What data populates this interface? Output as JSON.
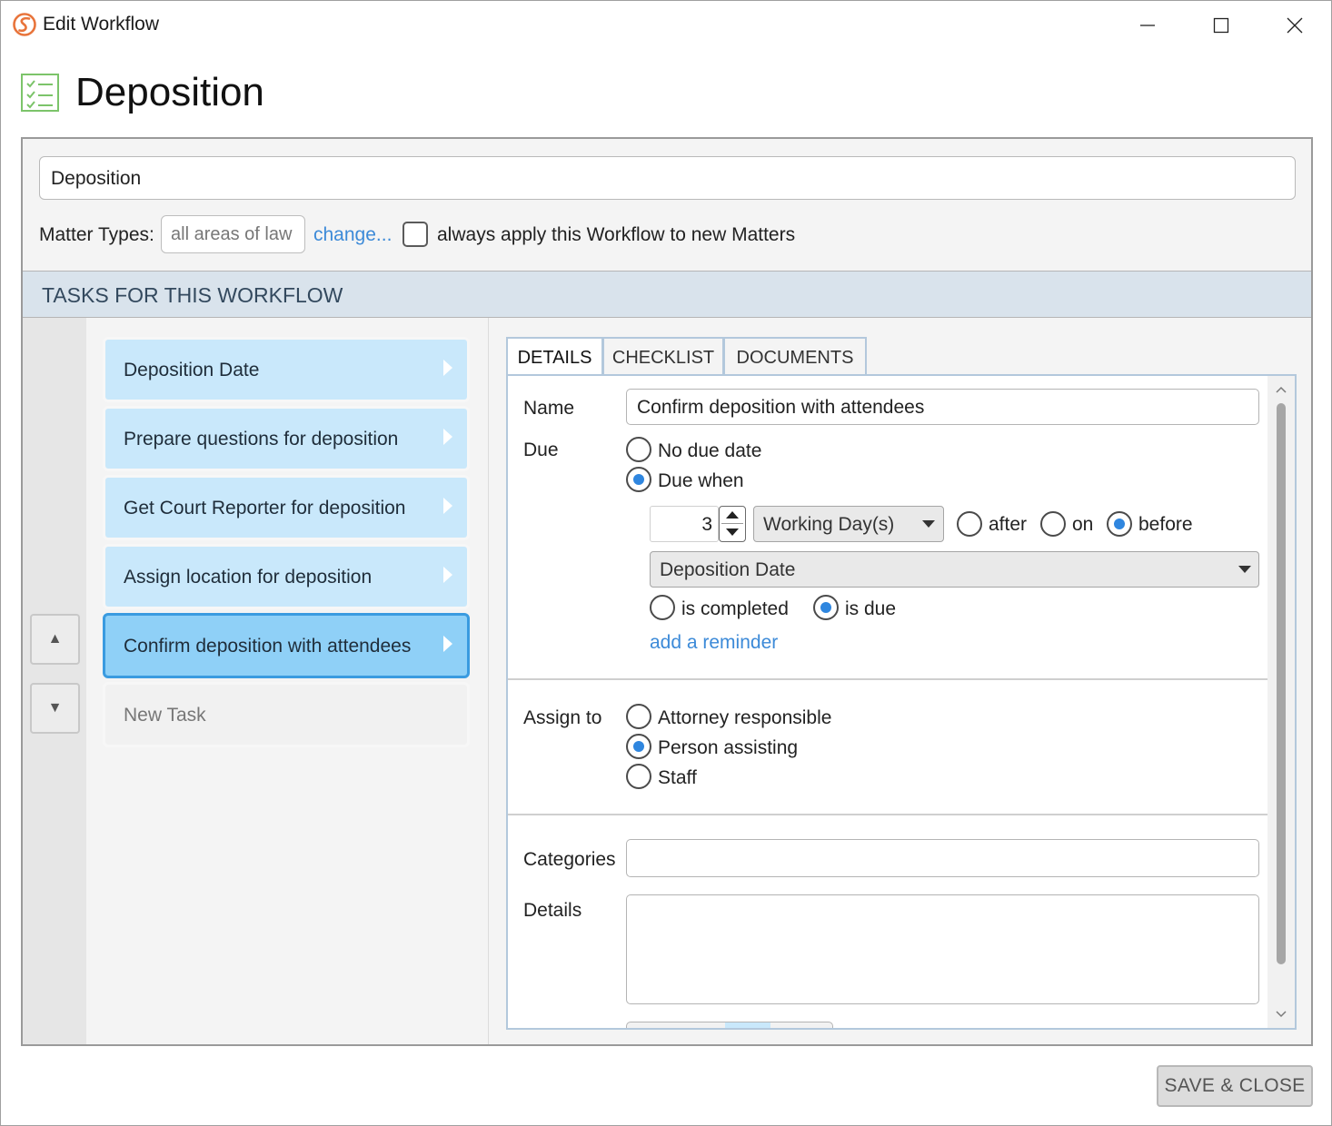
{
  "window": {
    "title": "Edit Workflow",
    "controls": {
      "minimize": "minimize",
      "maximize": "maximize",
      "close": "close"
    }
  },
  "header": {
    "title": "Deposition",
    "icon": "checklist-icon"
  },
  "workflow": {
    "name_value": "Deposition",
    "matter_types_label": "Matter Types:",
    "matter_types_value": "all areas of law",
    "change_link": "change...",
    "always_apply_label": "always apply this Workflow to new Matters",
    "always_apply_checked": false
  },
  "tasks_section": {
    "title": "TASKS FOR THIS WORKFLOW"
  },
  "tasks": [
    {
      "label": "Deposition Date",
      "selected": false
    },
    {
      "label": "Prepare questions for deposition",
      "selected": false
    },
    {
      "label": "Get Court Reporter for deposition",
      "selected": false
    },
    {
      "label": "Assign location for deposition",
      "selected": false
    },
    {
      "label": "Confirm deposition with attendees",
      "selected": true
    }
  ],
  "new_task_label": "New Task",
  "move_buttons": {
    "up": "▲",
    "down": "▼"
  },
  "tabs": [
    {
      "label": "DETAILS",
      "active": true
    },
    {
      "label": "CHECKLIST",
      "active": false
    },
    {
      "label": "DOCUMENTS",
      "active": false
    }
  ],
  "details": {
    "name_label": "Name",
    "name_value": "Confirm deposition with attendees",
    "due_label": "Due",
    "due_options": {
      "no_due_date": "No due date",
      "due_when": "Due when",
      "selected": "due_when"
    },
    "due_amount": "3",
    "due_unit": "Working Day(s)",
    "relation_options": {
      "after": "after",
      "on": "on",
      "before": "before",
      "selected": "before"
    },
    "related_task": "Deposition Date",
    "trigger_options": {
      "is_completed": "is completed",
      "is_due": "is due",
      "selected": "is_due"
    },
    "add_reminder": "add a reminder",
    "assign_label": "Assign to",
    "assign_options": {
      "attorney": "Attorney responsible",
      "person_assisting": "Person assisting",
      "staff": "Staff",
      "selected": "person_assisting"
    },
    "categories_label": "Categories",
    "categories_value": "",
    "details_label": "Details",
    "details_value": ""
  },
  "footer": {
    "save_close": "SAVE & CLOSE"
  },
  "colors": {
    "accent_blue": "#2f86df",
    "link_blue": "#3c8ad8",
    "task_bg": "#c9e8fb",
    "task_selected_bg": "#8fd0f7",
    "section_band": "#d9e3ec",
    "logo_orange": "#e8743b",
    "checklist_green": "#7cc46a"
  }
}
